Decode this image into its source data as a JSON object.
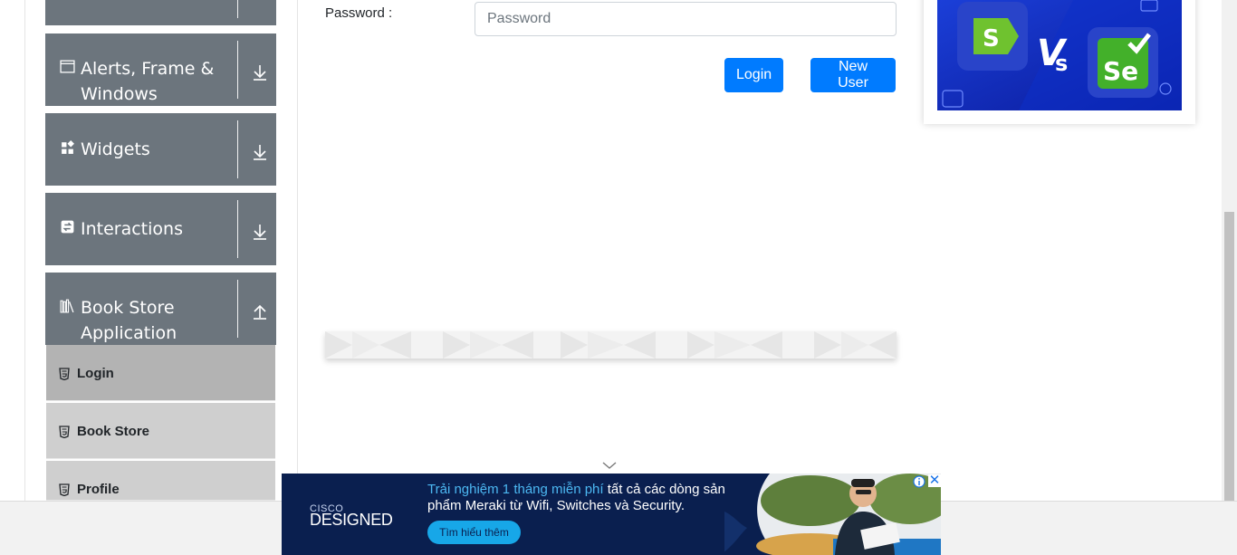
{
  "sidebar": {
    "groups": [
      {
        "label": ""
      },
      {
        "label": "Alerts, Frame &\nWindows",
        "line1": "Alerts, Frame &",
        "line2": "Windows",
        "icon": "window-icon"
      },
      {
        "label": "Widgets",
        "icon": "widgets-icon"
      },
      {
        "label": "Interactions",
        "icon": "interactions-icon"
      },
      {
        "label": "Book Store Application",
        "line1": "Book Store",
        "line2": "Application",
        "icon": "books-icon"
      }
    ],
    "book_store_items": [
      {
        "label": "Login"
      },
      {
        "label": "Book Store"
      },
      {
        "label": "Profile"
      }
    ]
  },
  "form": {
    "password_label": "Password :",
    "password_placeholder": "Password",
    "login_button": "Login",
    "new_user_button": "New User"
  },
  "ad": {
    "brand_top": "CISCO",
    "brand": "DESIGNED",
    "text_highlight": "Trải nghiệm 1 tháng miễn phí",
    "text_rest": " tất cả các dòng sản phẩm Meraki từ Wifi, Switches và Security.",
    "cta": "Tìm hiểu thêm",
    "close": "✕"
  },
  "colors": {
    "sidebar_group": "#6c757d",
    "sub_active": "#b3b3b3",
    "sub_item": "#cfcfcf",
    "primary": "#007bff",
    "ad_bg": "#0a1f4f"
  }
}
